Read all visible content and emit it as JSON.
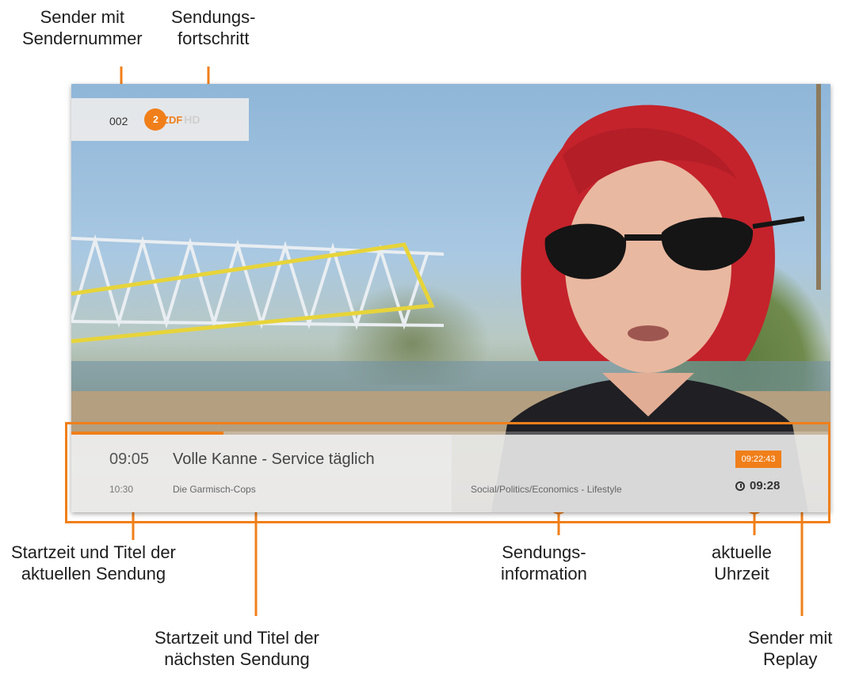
{
  "annotations": {
    "sender_mit_sendernummer": "Sender mit\nSendernummer",
    "sendungsfortschritt": "Sendungs-\nfortschritt",
    "startzeit_titel_aktuell": "Startzeit und Titel der\naktuellen Sendung",
    "startzeit_titel_naechste": "Startzeit und Titel der\nnächsten Sendung",
    "sendungsinformation": "Sendungs-\ninformation",
    "aktuelle_uhrzeit": "aktuelle\nUhrzeit",
    "sender_mit_replay": "Sender mit\nReplay"
  },
  "tv": {
    "channel_number": "002",
    "channel_logo_main": "ZDF",
    "channel_logo_suffix": "HD",
    "progress_fraction": 0.2,
    "now": {
      "start": "09:05",
      "title": "Volle Kanne - Service täglich"
    },
    "next": {
      "start": "10:30",
      "title": "Die Garmisch-Cops"
    },
    "genre": "Social/Politics/Economics - Lifestyle",
    "replay_time": "09:22:43",
    "current_time": "09:28",
    "clock_icon": "clock-icon"
  },
  "colors": {
    "accent": "#f07f1a",
    "annotation_text": "#1e1e1e"
  }
}
